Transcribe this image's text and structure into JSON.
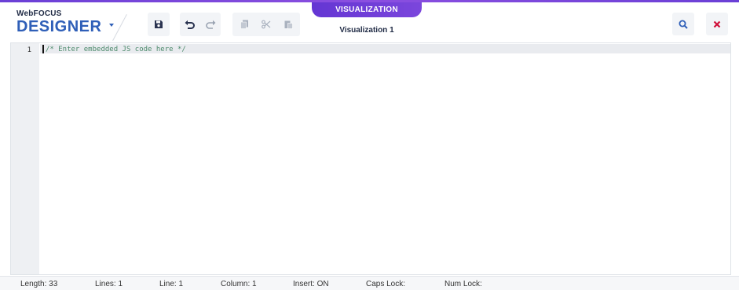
{
  "brand": {
    "small": "WebFOCUS",
    "big": "DESIGNER"
  },
  "toolbar": {
    "save_icon": "save-icon",
    "undo_icon": "undo-icon",
    "redo_icon": "redo-icon",
    "copy_icon": "copy-icon",
    "cut_icon": "cut-icon",
    "paste_icon": "paste-icon"
  },
  "center": {
    "tab_label": "VISUALIZATION",
    "subtitle": "Visualization 1"
  },
  "right": {
    "search_icon": "search-icon",
    "close_icon": "close-icon"
  },
  "editor": {
    "line_number": "1",
    "code": "/* Enter embedded JS code here */"
  },
  "status": {
    "length": "Length: 33",
    "lines": "Lines: 1",
    "line": "Line: 1",
    "column": "Column: 1",
    "insert": "Insert: ON",
    "caps": "Caps Lock:",
    "num": "Num Lock:"
  },
  "colors": {
    "accent": "#6a3fd6",
    "brand": "#2f5fb8",
    "close": "#d0103a"
  }
}
